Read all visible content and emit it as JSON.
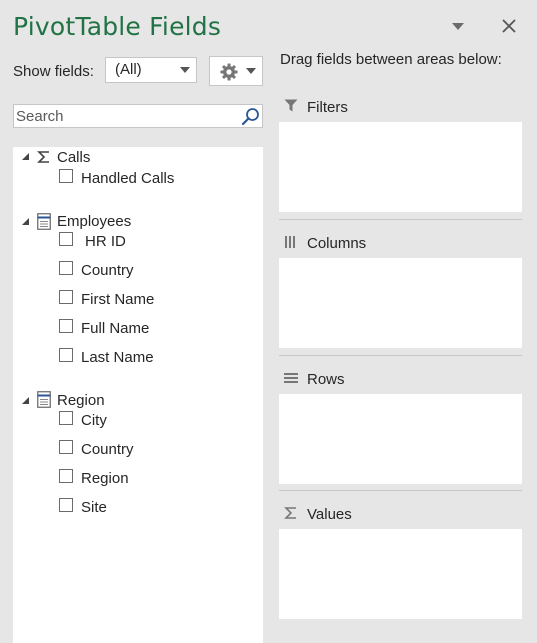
{
  "panel": {
    "title": "PivotTable Fields"
  },
  "show_fields": {
    "label": "Show fields:",
    "selected": "(All)"
  },
  "search": {
    "placeholder": "Search"
  },
  "tables": [
    {
      "name": "Calls",
      "icon": "sigma-icon",
      "fields": [
        "Handled Calls"
      ]
    },
    {
      "name": "Employees",
      "icon": "table-icon",
      "fields": [
        "HR ID",
        "Country",
        "First Name",
        "Full Name",
        "Last Name"
      ]
    },
    {
      "name": "Region",
      "icon": "table-icon",
      "fields": [
        "City",
        "Country",
        "Region",
        "Site"
      ]
    }
  ],
  "areas": {
    "hint": "Drag fields between areas below:",
    "filters": "Filters",
    "columns": "Columns",
    "rows": "Rows",
    "values": "Values"
  },
  "colors": {
    "title_green": "#217346",
    "panel_bg": "#e6e6e6"
  }
}
